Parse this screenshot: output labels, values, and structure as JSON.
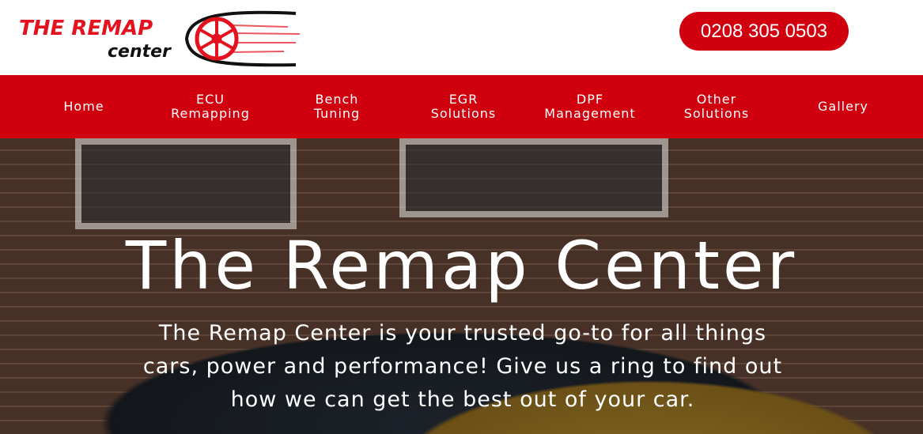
{
  "header": {
    "logo": {
      "line1": "THE REMAP",
      "line2": "center"
    },
    "phone": "0208 305 0503"
  },
  "nav": [
    {
      "line1": "Home",
      "line2": ""
    },
    {
      "line1": "ECU",
      "line2": "Remapping"
    },
    {
      "line1": "Bench",
      "line2": "Tuning"
    },
    {
      "line1": "EGR",
      "line2": "Solutions"
    },
    {
      "line1": "DPF",
      "line2": "Management"
    },
    {
      "line1": "Other",
      "line2": "Solutions"
    },
    {
      "line1": "Gallery",
      "line2": ""
    }
  ],
  "hero": {
    "title": "The Remap Center",
    "text": "The Remap Center is your trusted go-to for all things cars, power and performance! Give us a ring to find out how we can get the best out of your car."
  },
  "colors": {
    "brand": "#d0000f"
  }
}
